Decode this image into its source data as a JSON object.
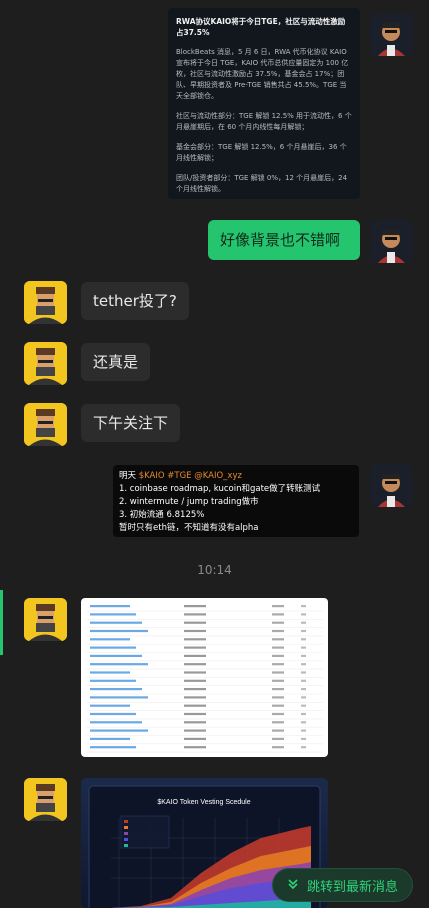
{
  "messages": {
    "news": {
      "title": "RWA协议KAIO将于今日TGE，社区与流动性激励占37.5%",
      "paragraphs": [
        "BlockBeats 消息，5 月 6 日，RWA 代币化协议 KAIO 宣布将于今日 TGE，KAIO 代币总供应量固定为 100 亿枚，社区与流动性激励占 37.5%，基金会占 17%；团队、早期投资者及 Pre-TGE 销售共占 45.5%。TGE 当天全部锁仓。",
        "社区与流动性部分：TGE 解锁 12.5% 用于流动性，6 个月悬崖期后，在 60 个月内线性每月解锁；",
        "基金会部分：TGE 解锁 12.5%，6 个月悬崖后，36 个月线性解锁；",
        "团队/投资者部分：TGE 解锁 0%，12 个月悬崖后，24 个月线性解锁。"
      ]
    },
    "green_bubble": "好像背景也不错啊",
    "left_1": "tether投了?",
    "left_2": "还真是",
    "left_3": "下午关注下",
    "tweet": {
      "line1_prefix": "明天 ",
      "line1_hl": "$KAIO #TGE @KAIO_xyz",
      "line2": "1. coinbase roadmap, kucoin和gate做了转账测试",
      "line3": "2. wintermute / jump trading做市",
      "line4": "3. 初始流通 6.8125%",
      "line5": "暂时只有eth链，不知道有没有alpha"
    },
    "timestamp": "10:14",
    "chart_title": "$KAIO Token Vesting Scedule"
  },
  "jump_button": {
    "label": "跳转到最新消息",
    "icon": "double-chevron-down-icon"
  },
  "colors": {
    "accent_green": "#24c56e",
    "background": "#1e1e1e"
  }
}
